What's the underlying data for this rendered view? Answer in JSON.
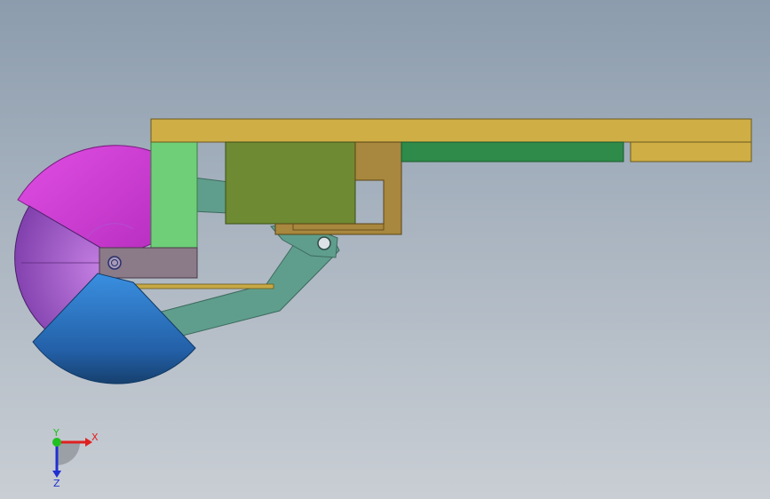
{
  "viewport": {
    "background_top": "#8c9cad",
    "background_bottom": "#c9ced4"
  },
  "parts": {
    "top_plate_color": "#cfae45",
    "green_block_color": "#6ecf78",
    "olive_block_color": "#6e8a32",
    "bracket_color": "#a8873e",
    "dark_green_bar_color": "#2e8b4a",
    "link_color": "#5f9e8c",
    "slider_color": "#8b7a88",
    "magenta_sector_color": "#d43fd8",
    "purple_sector_color": "#9a52c4",
    "blue_sector_color": "#2a6fc0"
  },
  "triad": {
    "x_label": "X",
    "y_label": "Y",
    "z_label": "Z",
    "x_color": "#e02020",
    "y_color": "#20c020",
    "z_color": "#2030d0"
  }
}
